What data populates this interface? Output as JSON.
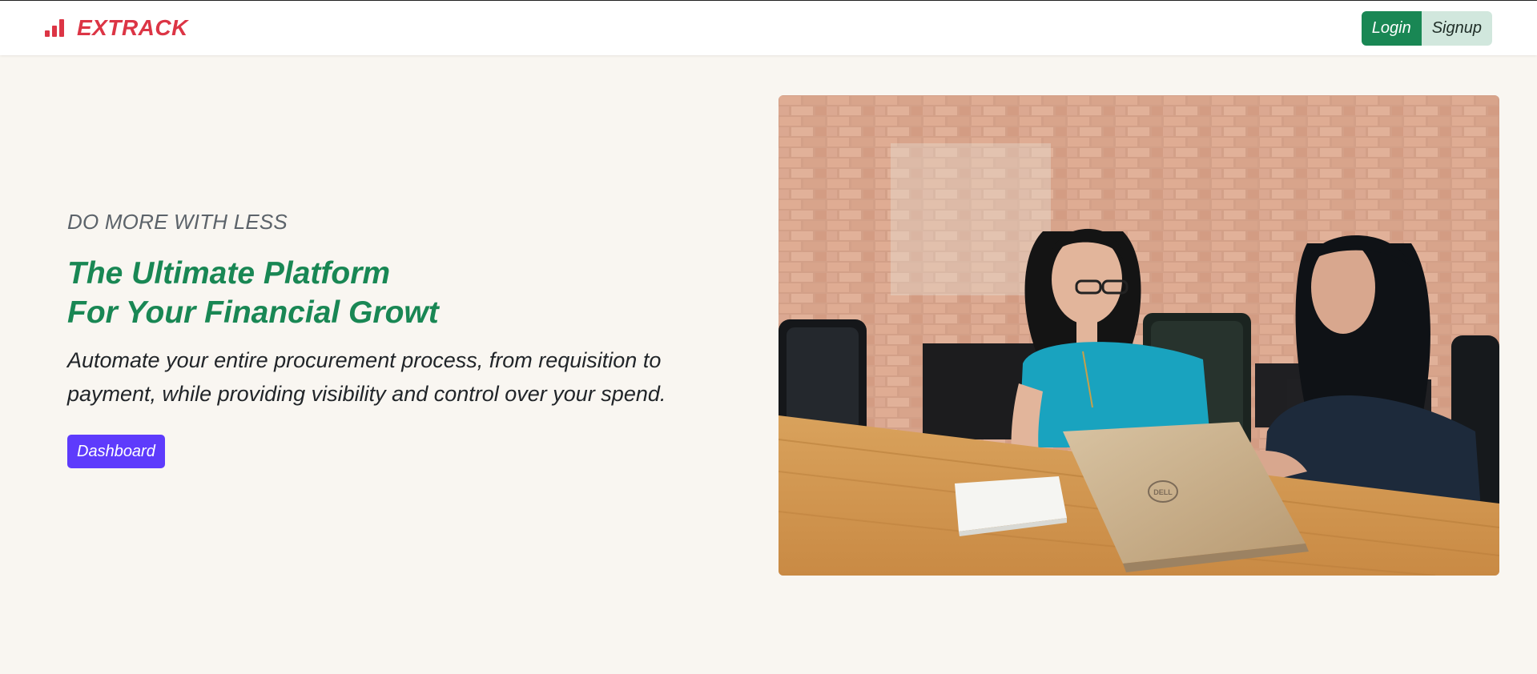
{
  "nav": {
    "brand": "EXTRACK",
    "brand_icon": "bar-chart-icon",
    "login_label": "Login",
    "signup_label": "Signup"
  },
  "hero": {
    "eyebrow": "DO MORE WITH LESS",
    "headline_line1": "The Ultimate Platform",
    "headline_line2": "For Your Financial Growt",
    "subtext_line1": "Automate your entire procurement process, from requisition to",
    "subtext_line2": "payment, while providing visibility and control over your spend.",
    "cta_label": "Dashboard",
    "image_logo": "DELL"
  },
  "colors": {
    "brand": "#dc3545",
    "accent_green": "#198754",
    "cta_purple": "#5e3bfc",
    "background": "#f9f6f1"
  }
}
